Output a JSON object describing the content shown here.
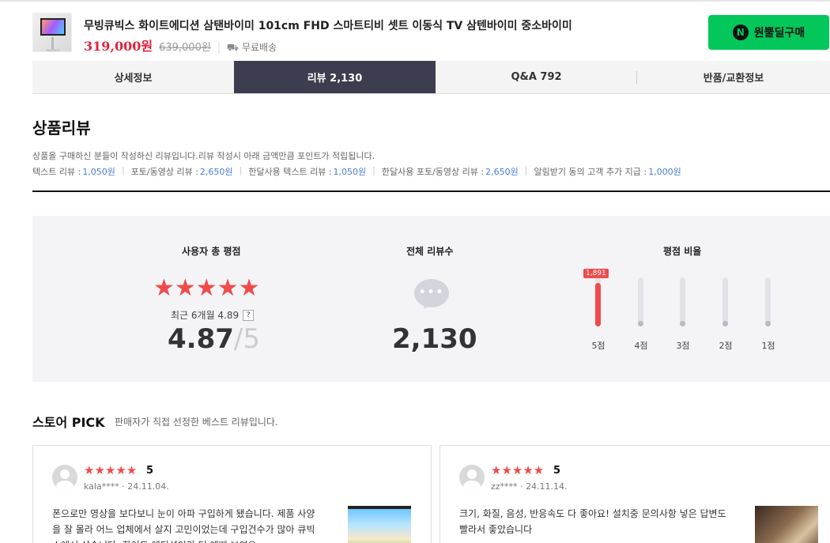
{
  "product": {
    "title": "무빙큐빅스 화이트에디션 삼탠바이미 101cm FHD 스마트티비 셋트 이동식 TV 삼텐바이미 중소바이미",
    "price": "319,000원",
    "original_price": "639,000원",
    "shipping": "무료배송",
    "buy_button": "원뿔딜구매",
    "buy_badge": "N"
  },
  "tabs": [
    {
      "label": "상세정보"
    },
    {
      "label": "리뷰 2,130",
      "active": true
    },
    {
      "label": "Q&A 792"
    },
    {
      "label": "반품/교환정보"
    }
  ],
  "review_header": {
    "title": "상품리뷰",
    "description": "상품을 구매하신 분들이 작성하신 리뷰입니다.리뷰 작성시 아래 금액만큼 포인트가 적립됩니다.",
    "points": [
      {
        "label": "텍스트 리뷰 :",
        "amount": "1,050원"
      },
      {
        "label": "포토/동영상 리뷰 :",
        "amount": "2,650원"
      },
      {
        "label": "한달사용 텍스트 리뷰 :",
        "amount": "1,050원"
      },
      {
        "label": "한달사용 포토/동영상 리뷰 :",
        "amount": "2,650원"
      },
      {
        "label": "알림받기 동의 고객 추가 지급 :",
        "amount": "1,000원"
      }
    ]
  },
  "summary": {
    "rating_heading": "사용자 총 평점",
    "stars": "★★★★★",
    "recent_text": "최근 6개월 4.89",
    "help": "?",
    "average": "4.87",
    "max": "5",
    "max_prefix": "/",
    "count_heading": "전체 리뷰수",
    "bubble_dots": "•••",
    "total": "2,130",
    "ratio_heading": "평점 비율",
    "ratio": [
      {
        "label": "5점",
        "count": "1,891",
        "fraction": 0.888
      },
      {
        "label": "4점",
        "count": "",
        "fraction": 0
      },
      {
        "label": "3점",
        "count": "",
        "fraction": 0
      },
      {
        "label": "2점",
        "count": "",
        "fraction": 0
      },
      {
        "label": "1점",
        "count": "",
        "fraction": 0
      }
    ]
  },
  "store_pick": {
    "title_ko": "스토어",
    "title_en": "PICK",
    "subtitle": "판매자가 직접 선정한 베스트 리뷰입니다."
  },
  "reviews": [
    {
      "stars": "★★★★★",
      "score": "5",
      "user": "kala****",
      "date": "24.11.04.",
      "text": "폰으로만 영상을 보다보니 눈이 아파 구입하게 됐습니다. 제품 사양을 잘 몰라 어느 업체에서 살지 고민이었는데 구입건수가 많아 큐빅스에서 샀습니다. 화이트 에디션이라 더 예뻐 보여요"
    },
    {
      "stars": "★★★★★",
      "score": "5",
      "user": "zz****",
      "date": "24.11.14.",
      "text": "크기, 화질, 음성, 반응속도 다 좋아요! 설치중 문의사항 넣은 답변도 빨라서 좋았습니다"
    }
  ],
  "colors": {
    "accent_red": "#f04b4b",
    "price_red": "#e1243b",
    "buy_green": "#03c75a",
    "tab_active": "#3c3d4f",
    "point_blue": "#4a7bd0"
  }
}
